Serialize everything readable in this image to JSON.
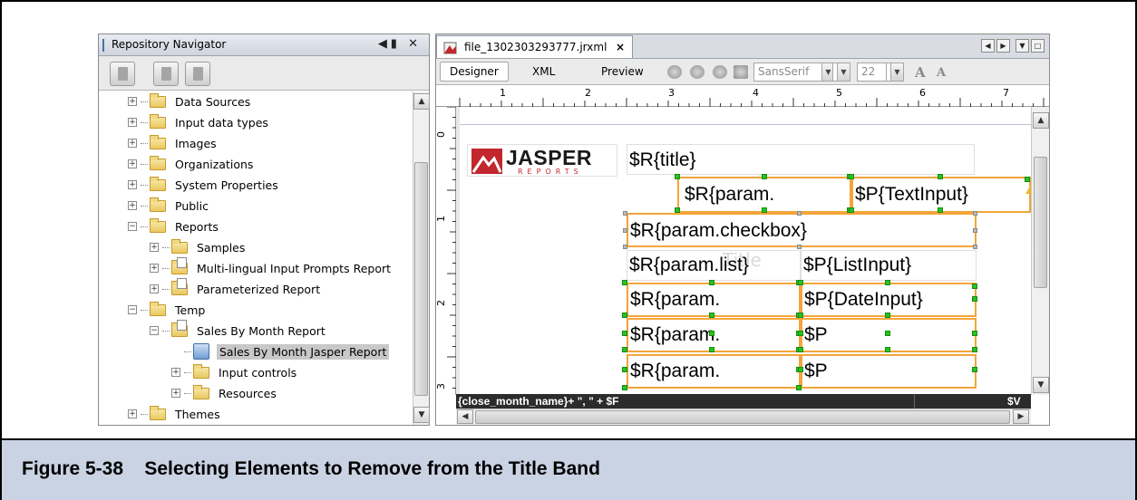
{
  "figure": {
    "caption": "Figure 5-38    Selecting Elements to Remove from the Title Band"
  },
  "navigator": {
    "title": "Repository Navigator",
    "controls": "◀▮ ✕",
    "tree": [
      {
        "label": "Data Sources",
        "level": 1,
        "expander": "+",
        "icon": "folder-icon"
      },
      {
        "label": "Input data types",
        "level": 1,
        "expander": "+",
        "icon": "folder-icon"
      },
      {
        "label": "Images",
        "level": 1,
        "expander": "+",
        "icon": "folder-icon"
      },
      {
        "label": "Organizations",
        "level": 1,
        "expander": "+",
        "icon": "folder-icon"
      },
      {
        "label": "System Properties",
        "level": 1,
        "expander": "+",
        "icon": "folder-icon"
      },
      {
        "label": "Public",
        "level": 1,
        "expander": "+",
        "icon": "folder-icon"
      },
      {
        "label": "Reports",
        "level": 1,
        "expander": "−",
        "icon": "folder-icon"
      },
      {
        "label": "Samples",
        "level": 2,
        "expander": "+",
        "icon": "folder-icon"
      },
      {
        "label": "Multi-lingual Input Prompts Report",
        "level": 2,
        "expander": "+",
        "icon": "report-unit-icon"
      },
      {
        "label": "Parameterized Report",
        "level": 2,
        "expander": "+",
        "icon": "report-unit-icon"
      },
      {
        "label": "Temp",
        "level": 1,
        "expander": "−",
        "icon": "folder-icon"
      },
      {
        "label": "Sales By Month Report",
        "level": 2,
        "expander": "−",
        "icon": "report-unit-icon"
      },
      {
        "label": "Sales By Month Jasper Report",
        "level": 3,
        "expander": "",
        "icon": "jrxml-icon",
        "selected": true
      },
      {
        "label": "Input controls",
        "level": 3,
        "expander": "+",
        "icon": "folder-icon"
      },
      {
        "label": "Resources",
        "level": 3,
        "expander": "+",
        "icon": "folder-icon"
      },
      {
        "label": "Themes",
        "level": 1,
        "expander": "+",
        "icon": "folder-icon"
      }
    ]
  },
  "editor": {
    "file_tab": "file_1302303293777.jrxml",
    "close_glyph": "×",
    "modes": {
      "designer": "Designer",
      "xml": "XML",
      "preview": "Preview"
    },
    "font_name": "SansSerif",
    "font_size": "22",
    "font_grow": "A",
    "font_shrink": "A",
    "ruler_top": [
      "1",
      "2",
      "3",
      "4",
      "5",
      "6",
      "7"
    ],
    "ruler_left": [
      "0",
      "1",
      "2",
      "3"
    ],
    "logo": {
      "word": "JASPER",
      "sub": "REPORTS"
    },
    "fields": {
      "title": "$R{title}",
      "param_1": "$R{param.",
      "text_input": "$P{TextInput}",
      "checkbox": "$R{param.checkbox}",
      "list": "$R{param.list}",
      "list_input": "$P{ListInput}",
      "param_2": "$R{param.",
      "date_input": "$P{DateInput}",
      "param_3": "$R{param.",
      "p_3": "$P",
      "param_4": "$R{param.",
      "p_4": "$P"
    },
    "ghost_title": "Title",
    "expression_left": "{close_month_name}+ \", \" + $F",
    "expression_right": "$V"
  }
}
